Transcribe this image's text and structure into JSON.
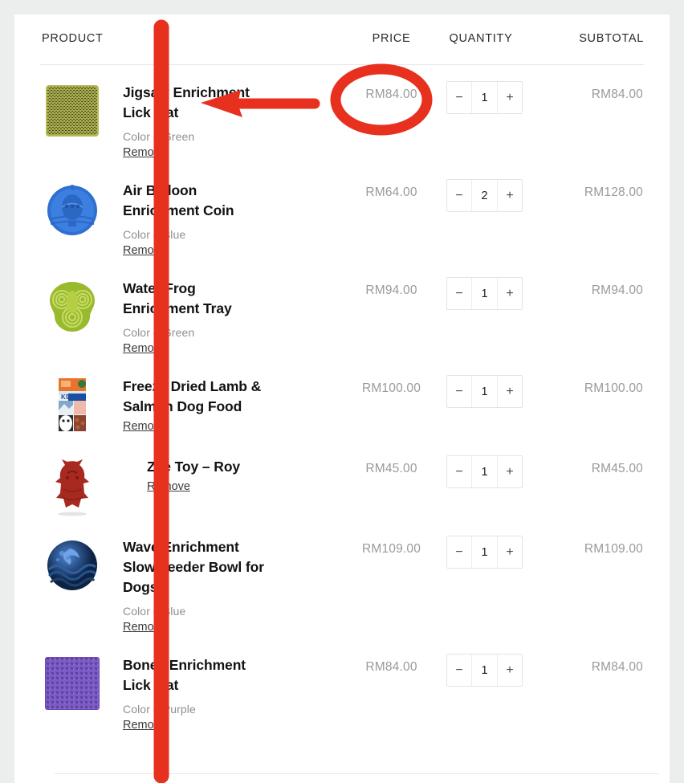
{
  "table": {
    "headers": {
      "product": "PRODUCT",
      "price": "PRICE",
      "quantity": "QUANTITY",
      "subtotal": "SUBTOTAL"
    },
    "remove_label": "Remove",
    "decrement_label": "−",
    "increment_label": "+",
    "rows": [
      {
        "name": "Jigsaw Enrichment Lick Mat",
        "variant": "Color – Green",
        "price": "RM84.00",
        "quantity": "1",
        "subtotal": "RM84.00",
        "thumb": "jigsaw-lick-mat-green-thumbnail"
      },
      {
        "name": "Air Balloon Enrichment Coin",
        "variant": "Color – Blue",
        "price": "RM64.00",
        "quantity": "2",
        "subtotal": "RM128.00",
        "thumb": "air-balloon-coin-blue-thumbnail"
      },
      {
        "name": "Water Frog Enrichment Tray",
        "variant": "Color – Green",
        "price": "RM94.00",
        "quantity": "1",
        "subtotal": "RM94.00",
        "thumb": "water-frog-tray-green-thumbnail"
      },
      {
        "name": "Freeze Dried Lamb & Salmon Dog Food",
        "variant": "",
        "price": "RM100.00",
        "quantity": "1",
        "subtotal": "RM100.00",
        "thumb": "k9-natural-dog-food-pouch-thumbnail"
      },
      {
        "name": "Zee Toy – Roy",
        "variant": "",
        "price": "RM45.00",
        "quantity": "1",
        "subtotal": "RM45.00",
        "thumb": "zee-toy-roy-red-thumbnail"
      },
      {
        "name": "Wave Enrichment Slow Feeder Bowl for Dogs",
        "variant": "Color – Blue",
        "price": "RM109.00",
        "quantity": "1",
        "subtotal": "RM109.00",
        "thumb": "wave-slow-feeder-bowl-blue-thumbnail"
      },
      {
        "name": "Bones Enrichment Lick Mat",
        "variant": "Color – Purple",
        "price": "RM84.00",
        "quantity": "1",
        "subtotal": "RM84.00",
        "thumb": "bones-lick-mat-purple-thumbnail"
      }
    ]
  },
  "annotations": {
    "color": "#e8301f",
    "vertical_line": "red-vertical-line-annotation",
    "arrow": "red-left-arrow-annotation",
    "ellipse": "red-ellipse-highlight-annotation"
  },
  "colors": {
    "page_background": "#eceded",
    "card_background": "#ffffff",
    "muted_text": "#9a9a9a",
    "primary_text": "#121212",
    "divider": "#e6e6e6"
  }
}
